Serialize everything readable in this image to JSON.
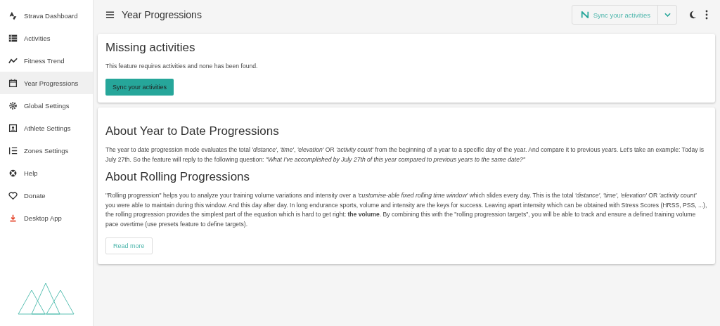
{
  "sidebar": {
    "items": [
      {
        "label": "Strava Dashboard",
        "selected": false
      },
      {
        "label": "Activities",
        "selected": false
      },
      {
        "label": "Fitness Trend",
        "selected": false
      },
      {
        "label": "Year Progressions",
        "selected": true
      },
      {
        "label": "Global Settings",
        "selected": false
      },
      {
        "label": "Athlete Settings",
        "selected": false
      },
      {
        "label": "Zones Settings",
        "selected": false
      },
      {
        "label": "Help",
        "selected": false
      },
      {
        "label": "Donate",
        "selected": false
      },
      {
        "label": "Desktop App",
        "selected": false
      }
    ]
  },
  "toolbar": {
    "title": "Year Progressions",
    "sync_button": "Sync your activities"
  },
  "missing_card": {
    "title": "Missing activities",
    "text": "This feature requires activities and none has been found.",
    "button": "Sync your activities"
  },
  "about_card": {
    "sections": [
      {
        "title": "About Year to Date Progressions",
        "text": "The year to date progression mode evaluates the total *'distance'*, *'time'*, *'elevation'* OR *'activity count'* from the beginning of a year to a specific day of the year. And compare it to previous years. Let's take an example: Today is July 27th. So the feature will reply to the following question: *\"What I've accomplished by July 27th of this year compared to previous years to the same date?\"*"
      },
      {
        "title": "About Rolling Progressions",
        "text": "\"Rolling progression\" helps you to analyze your training volume variations and intensity over a *'customise-able fixed rolling time window'* which slides every day. This is the total *'distance'*, *'time'*, *'elevation'* OR *'activity count'* you were able to maintain during this window. And this day after day. In long endurance sports, volume and intensity are the keys for success. Leaving apart intensity which can be obtained with Stress Scores (HRSS, PSS, ...), the rolling progression provides the simplest part of the equation which is hard to get right: **the volume**. By combining this with the \"rolling progression targets\", you will be able to track and ensure a defined training volume pace overtime (use presets feature to define targets)."
      }
    ],
    "button": "Read more"
  }
}
